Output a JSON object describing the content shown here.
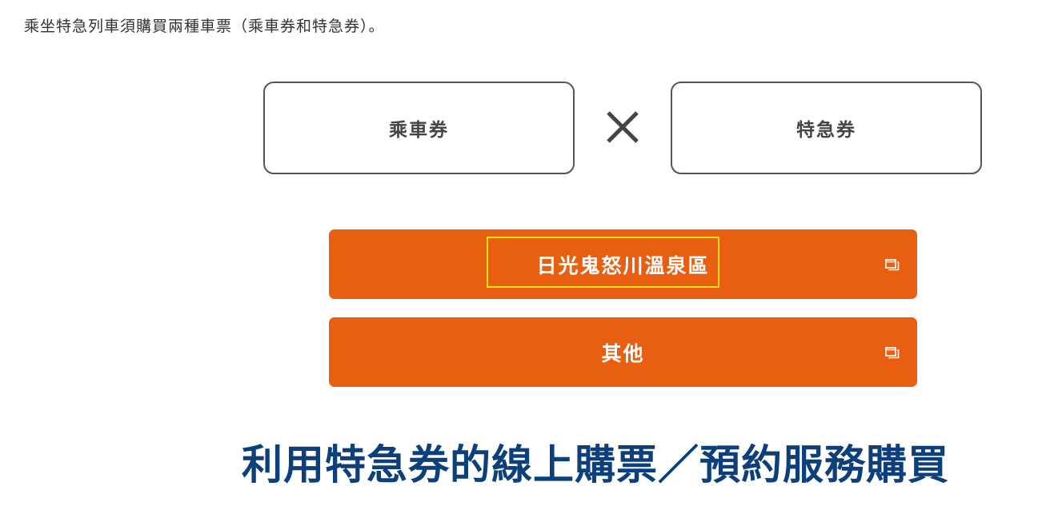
{
  "intro_text": "乘坐特急列車須購買兩種車票（乘車券和特急券）。",
  "tickets": {
    "left_label": "乘車券",
    "operator_icon": "times-icon",
    "right_label": "特急券"
  },
  "area_buttons": [
    {
      "label": "日光鬼怒川溫泉區",
      "icon": "external-window-icon",
      "focused": true
    },
    {
      "label": "其他",
      "icon": "external-window-icon",
      "focused": false
    }
  ],
  "section_heading": "利用特急券的線上購票／預約服務購買",
  "colors": {
    "button_orange": "#e85f11",
    "heading_blue": "#0d3f7a",
    "box_border": "#555555",
    "focus_outline": "#f2e21a"
  }
}
